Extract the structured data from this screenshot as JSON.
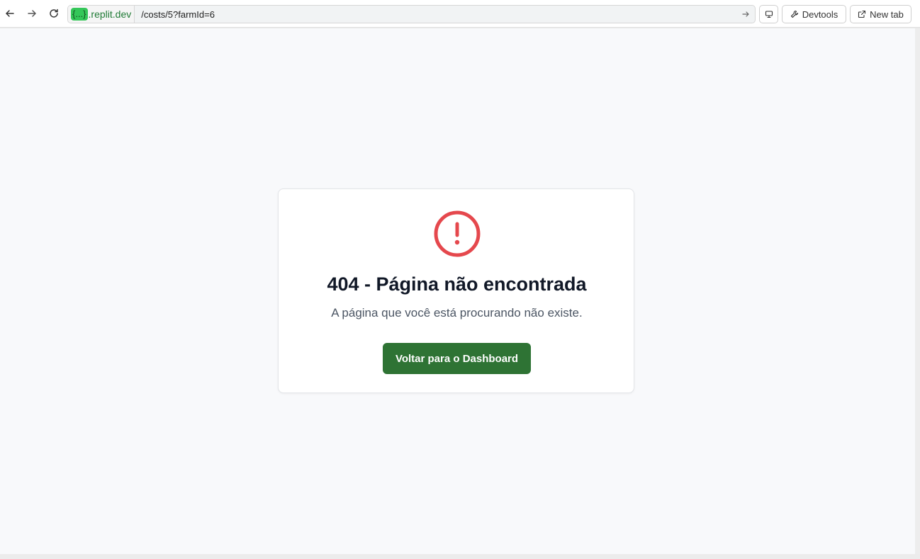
{
  "browser": {
    "url_badge": "{...}",
    "url_domain": ".replit.dev",
    "url_path": "/costs/5?farmId=6",
    "devtools_label": "Devtools",
    "new_tab_label": "New tab",
    "icons": {
      "back": "arrow-left-icon",
      "forward": "arrow-right-icon",
      "reload": "reload-icon",
      "go": "arrow-right-icon",
      "screen": "monitor-icon",
      "devtools": "wrench-icon",
      "new_tab": "external-link-icon"
    }
  },
  "page": {
    "icon": "alert-circle-icon",
    "icon_color": "#e5484d",
    "title": "404 - Página não encontrada",
    "message": "A página que você está procurando não existe.",
    "button_label": "Voltar para o Dashboard",
    "button_color": "#2e7334"
  }
}
